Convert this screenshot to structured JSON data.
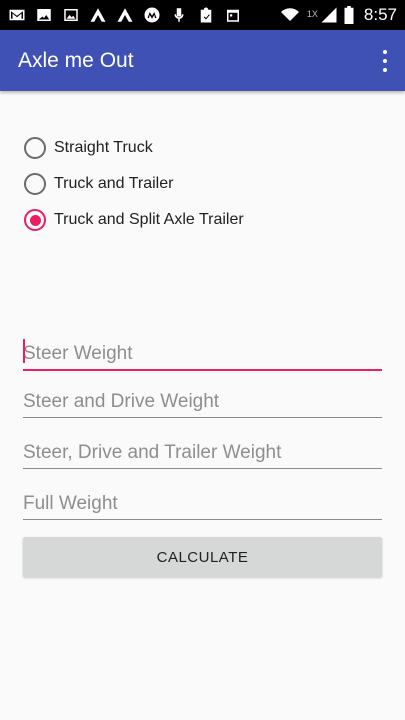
{
  "status_bar": {
    "left_icons": [
      "gmail-icon",
      "photo-icon",
      "image-icon",
      "app-a-icon",
      "app-a2-icon",
      "motorola-icon",
      "mic-icon",
      "clipboard-icon",
      "calendar-icon"
    ],
    "network_label": "1X",
    "time": "8:57"
  },
  "app_bar": {
    "title": "Axle me Out",
    "menu_icon": "more-vert-icon",
    "color": "#3f51b5"
  },
  "truck_type": {
    "options": [
      {
        "label": "Straight Truck",
        "checked": false
      },
      {
        "label": "Truck and Trailer",
        "checked": false
      },
      {
        "label": "Truck and Split Axle Trailer",
        "checked": true
      }
    ],
    "accent": "#e91e63"
  },
  "fields": {
    "steer": {
      "placeholder": "Steer Weight",
      "value": ""
    },
    "steer_drive": {
      "placeholder": "Steer and Drive Weight",
      "value": ""
    },
    "steer_drive_trailer": {
      "placeholder": "Steer, Drive and Trailer Weight",
      "value": ""
    },
    "full": {
      "placeholder": "Full Weight",
      "value": ""
    }
  },
  "actions": {
    "calculate_label": "CALCULATE"
  }
}
